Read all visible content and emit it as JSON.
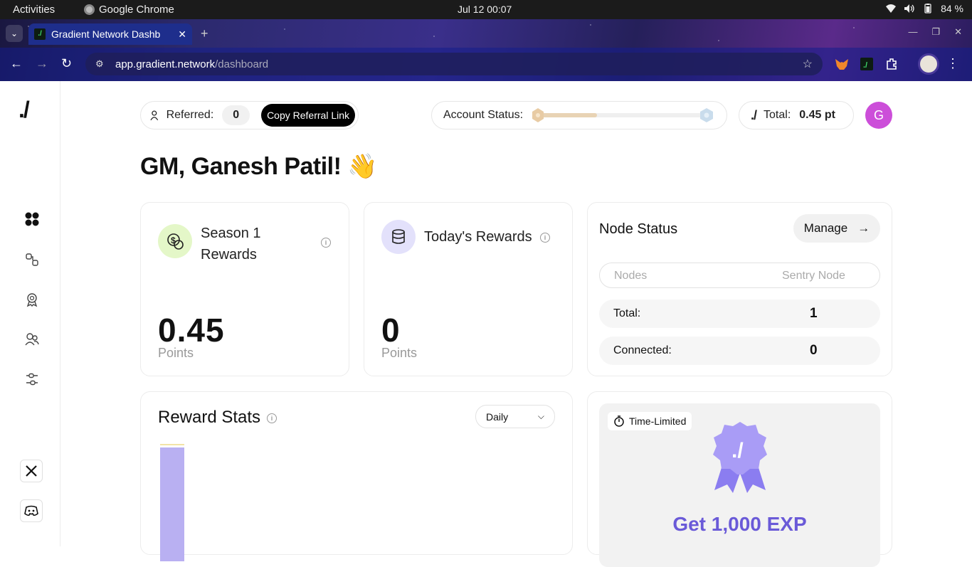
{
  "os": {
    "activities": "Activities",
    "app_name": "Google Chrome",
    "clock": "Jul 12  00:07",
    "battery": "84 %"
  },
  "browser": {
    "tab_title": "Gradient Network Dashb",
    "url_host": "app.gradient.network",
    "url_path": "/dashboard"
  },
  "sidebar": {
    "logo": "./",
    "items": [
      "dashboard-icon",
      "nodes-icon",
      "rewards-icon",
      "referrals-icon",
      "settings-icon"
    ],
    "social": [
      "x-icon",
      "discord-icon"
    ]
  },
  "header": {
    "referred_label": "Referred:",
    "referred_count": "0",
    "copy_referral": "Copy Referral Link",
    "account_status_label": "Account Status:",
    "account_status_level": 0.35,
    "total_mark": "./",
    "total_label": "Total:",
    "total_value": "0.45 pt",
    "avatar_letter": "G"
  },
  "greeting": "GM, Ganesh Patil! 👋",
  "cards": {
    "season": {
      "title": "Season 1 Rewards",
      "title_line1": "Season 1",
      "title_line2": "Rewards",
      "value": "0.45",
      "unit": "Points"
    },
    "today": {
      "title": "Today's Rewards",
      "value": "0",
      "unit": "Points"
    },
    "node_status": {
      "title": "Node Status",
      "manage": "Manage",
      "col_nodes": "Nodes",
      "col_sentry": "Sentry Node",
      "rows": [
        {
          "label": "Total:",
          "value": "1"
        },
        {
          "label": "Connected:",
          "value": "0"
        }
      ]
    },
    "reward_stats": {
      "title": "Reward Stats",
      "period": "Daily"
    },
    "promo": {
      "tag": "Time-Limited",
      "title": "Get 1,000 EXP"
    }
  },
  "colors": {
    "accent": "#6a5ad8",
    "bar": "#b9b0f2",
    "avatar": "#cc4ed9"
  }
}
